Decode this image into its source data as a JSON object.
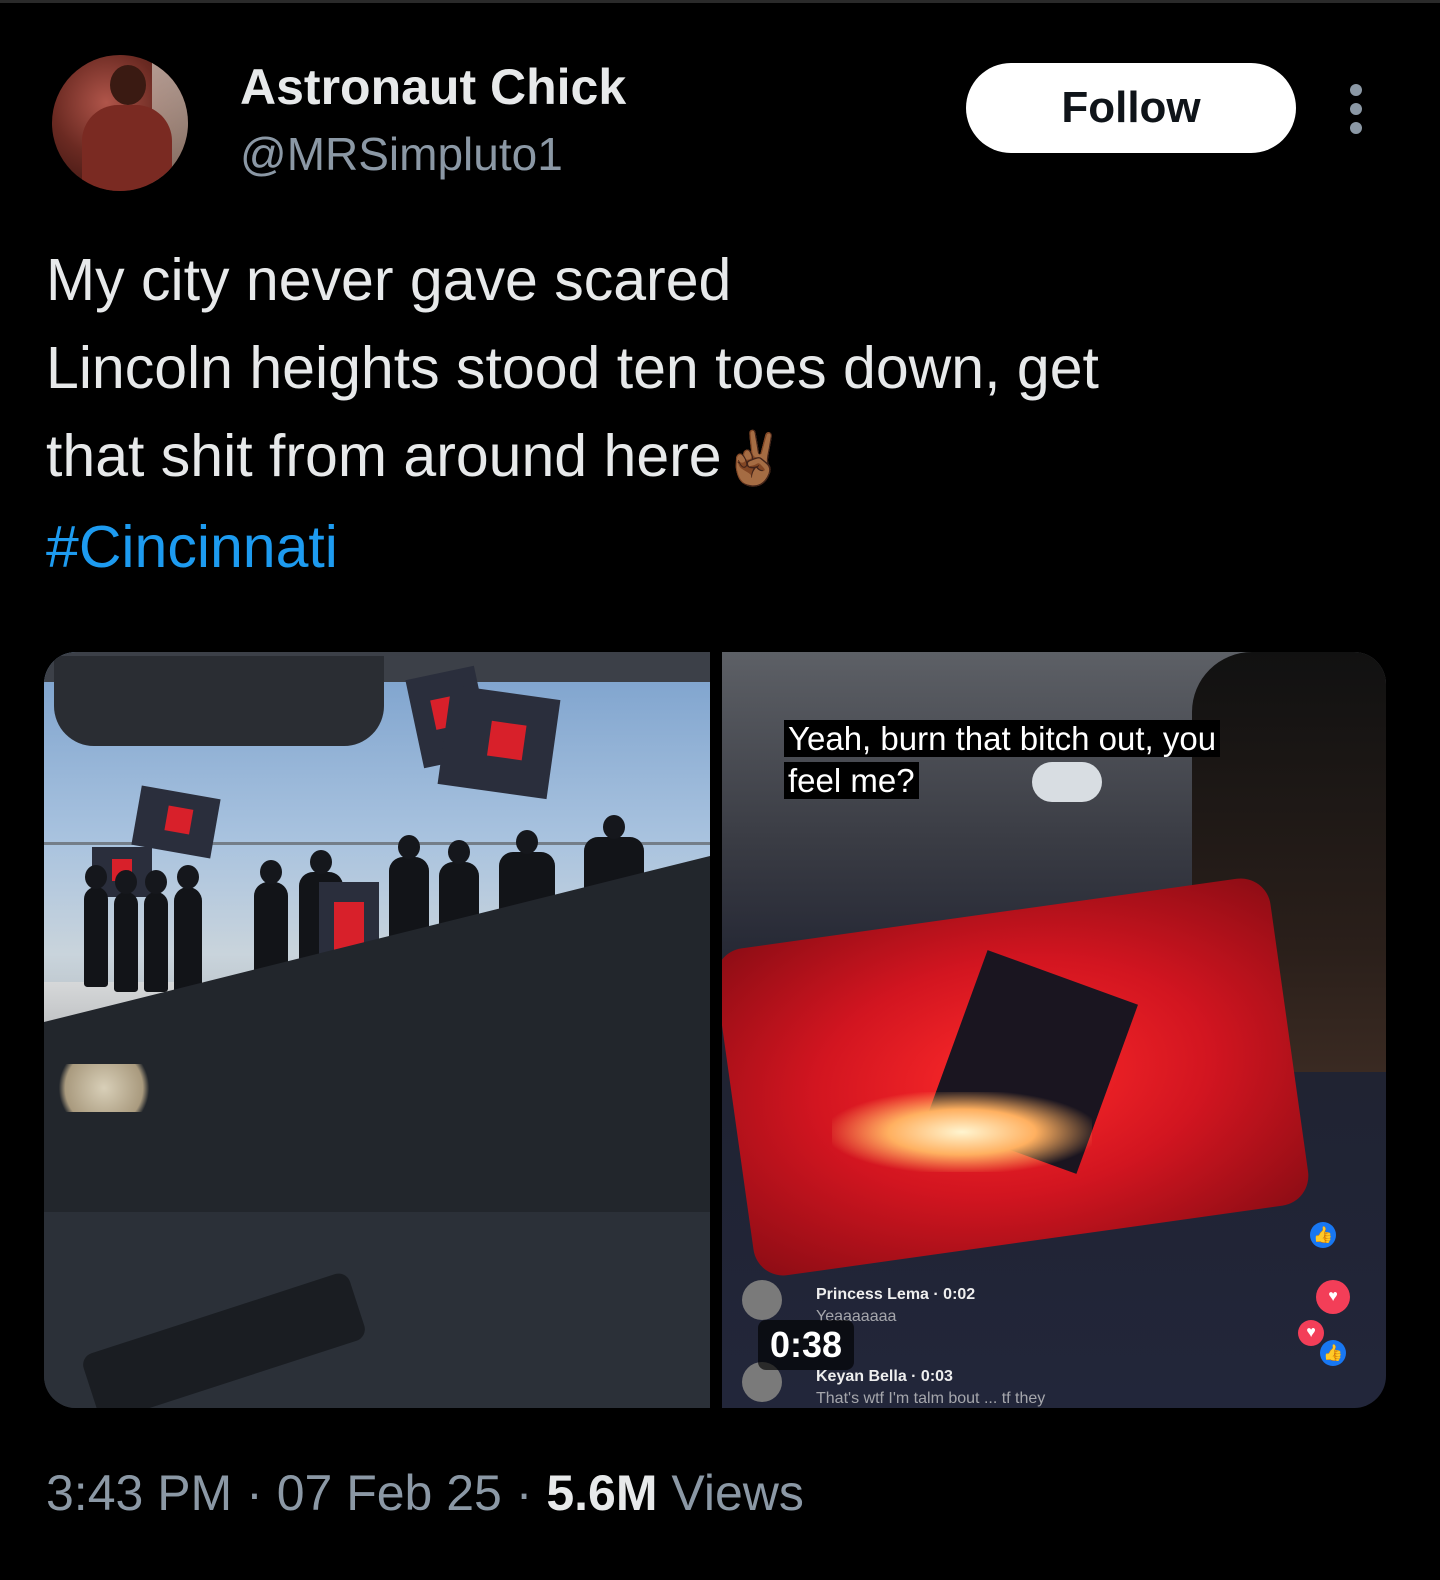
{
  "author": {
    "display_name": "Astronaut Chick",
    "handle": "@MRSimpluto1",
    "avatar_icon": "profile-photo"
  },
  "actions": {
    "follow_label": "Follow",
    "more_icon": "more-vertical-icon"
  },
  "tweet": {
    "lines": [
      "My city never gave scared",
      "Lincoln heights stood ten toes down, get",
      "that shit from around here"
    ],
    "emoji": "✌🏾",
    "hashtag": "#Cincinnati"
  },
  "media": {
    "right_video": {
      "caption": "Yeah, burn that bitch out, you feel me?",
      "duration": "0:38",
      "comments": [
        {
          "name": "Princess Lema · 0:02",
          "text": "Yeaaaaaaa"
        },
        {
          "name": "Keyan Bella · 0:03",
          "text": "That's wtf I'm talm bout ... tf they"
        }
      ]
    }
  },
  "meta": {
    "time": "3:43 PM",
    "separator": "·",
    "date": "07 Feb 25",
    "views_count": "5.6M",
    "views_label": "Views"
  },
  "colors": {
    "background": "#000000",
    "hashtag": "#1d9bf0",
    "secondary_text": "#8b98a5",
    "primary_text": "#e7e9ea"
  }
}
